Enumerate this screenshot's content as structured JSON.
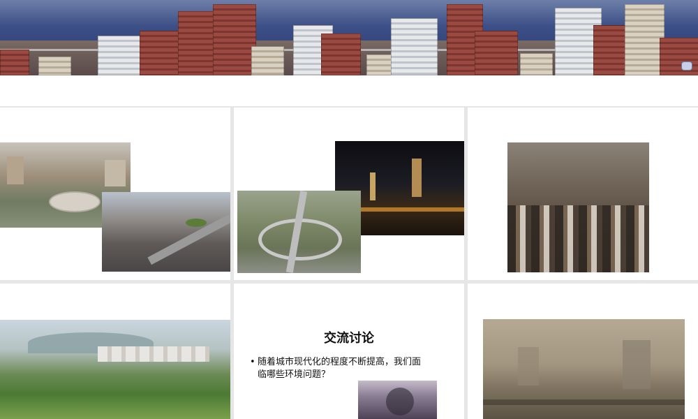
{
  "banner": {
    "label": "city-banner"
  },
  "slides": [
    {
      "id": "s1",
      "photos": [
        "square-photo",
        "traffic-photo"
      ]
    },
    {
      "id": "s2",
      "photos": [
        "night-city-photo",
        "interchange-photo"
      ]
    },
    {
      "id": "s3",
      "photos": [
        "crowd-photo"
      ]
    },
    {
      "id": "s4",
      "photos": [
        "park-photo"
      ]
    },
    {
      "id": "s5",
      "title": "交流讨论",
      "bullet_line1": "随着城市现代化的程度不断提高，我们面",
      "bullet_line2": "临哪些环境问题？",
      "bullet_marker": "•"
    },
    {
      "id": "s6",
      "photos": [
        "smog-photo"
      ]
    }
  ],
  "colors": {
    "background": "#e6e6e6",
    "slide": "#ffffff"
  }
}
